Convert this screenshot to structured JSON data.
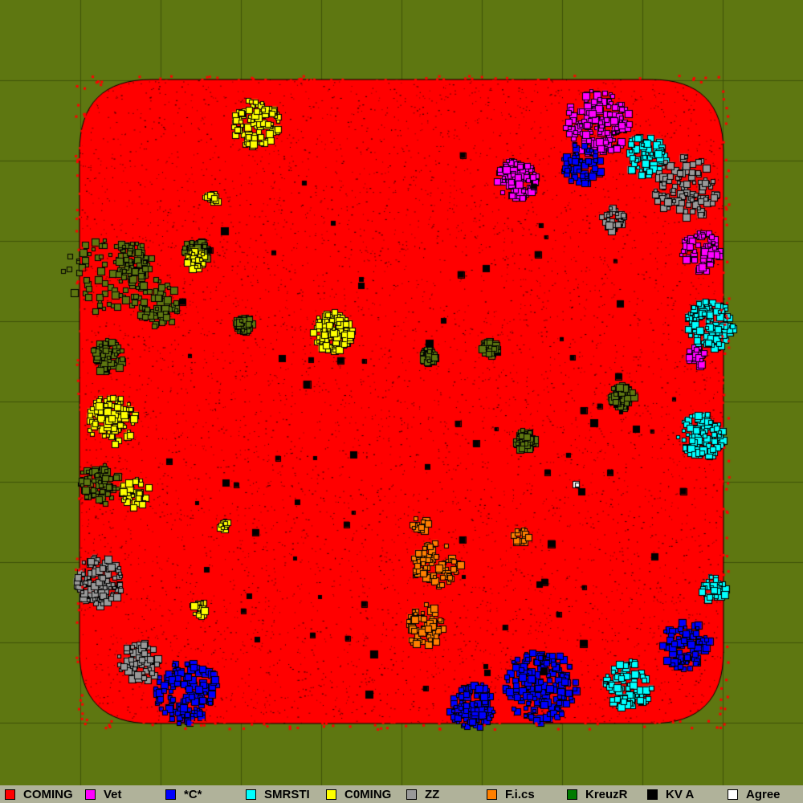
{
  "board": {
    "background_color": "#5e7711",
    "grid_line_color": "#3f5208",
    "territory_border_color": "#000000"
  },
  "legend": [
    {
      "label": "COMING",
      "color": "#ff0000"
    },
    {
      "label": "Vet",
      "color": "#ff00ff"
    },
    {
      "label": "*C*",
      "color": "#0000ff"
    },
    {
      "label": "SMRSTI",
      "color": "#00ffff"
    },
    {
      "label": "C0MING",
      "color": "#ffff00"
    },
    {
      "label": "ZZ",
      "color": "#999999"
    },
    {
      "label": "F.i.cs",
      "color": "#ff7f00"
    },
    {
      "label": "KreuzR",
      "color": "#007a00"
    },
    {
      "label": "KV A",
      "color": "#000000"
    },
    {
      "label": "Agree",
      "color": "#ffffff"
    }
  ]
}
